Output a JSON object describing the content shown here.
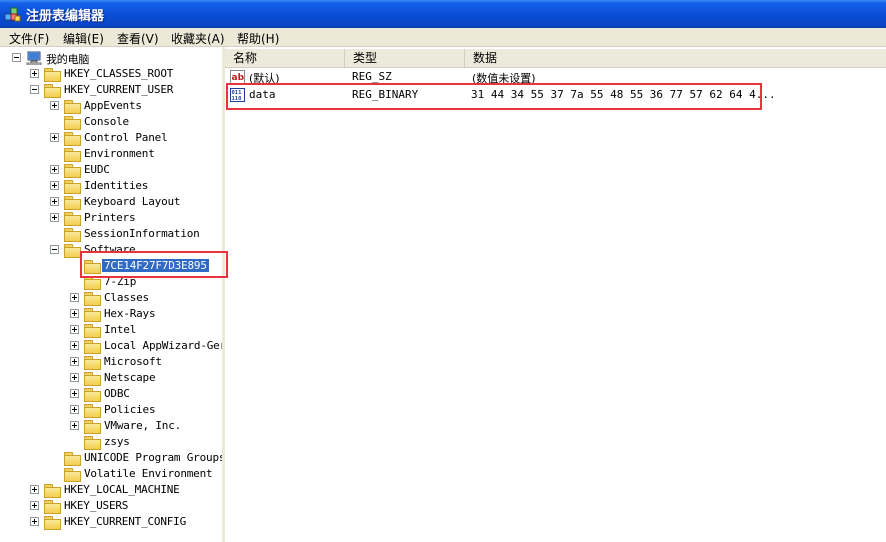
{
  "window": {
    "title": "注册表编辑器"
  },
  "menu": [
    {
      "label": "文件(F)"
    },
    {
      "label": "编辑(E)"
    },
    {
      "label": "查看(V)"
    },
    {
      "label": "收藏夹(A)"
    },
    {
      "label": "帮助(H)"
    }
  ],
  "tree": {
    "root": "我的电脑",
    "nodes": [
      "HKEY_CLASSES_ROOT",
      "HKEY_CURRENT_USER",
      "AppEvents",
      "Console",
      "Control Panel",
      "Environment",
      "EUDC",
      "Identities",
      "Keyboard Layout",
      "Printers",
      "SessionInformation",
      "Software",
      "7CE14F27F7D3E895",
      "7-Zip",
      "Classes",
      "Hex-Rays",
      "Intel",
      "Local AppWizard-Ger",
      "Microsoft",
      "Netscape",
      "ODBC",
      "Policies",
      "VMware, Inc.",
      "zsys",
      "UNICODE Program Groups",
      "Volatile Environment",
      "HKEY_LOCAL_MACHINE",
      "HKEY_USERS",
      "HKEY_CURRENT_CONFIG"
    ],
    "selected": "7CE14F27F7D3E895"
  },
  "list": {
    "columns": [
      "名称",
      "类型",
      "数据"
    ],
    "rows": [
      {
        "name": "(默认)",
        "type": "REG_SZ",
        "data": "(数值未设置)",
        "icon": "string-value-icon"
      },
      {
        "name": "data",
        "type": "REG_BINARY",
        "data": "31 44 34 55 37 7a 55 48 55 36 77 57 62 64 4...",
        "icon": "binary-value-icon"
      }
    ]
  },
  "colors": {
    "highlight": "#e8333e",
    "selection": "#316ac5",
    "titlebar": "#0a4fd6"
  }
}
